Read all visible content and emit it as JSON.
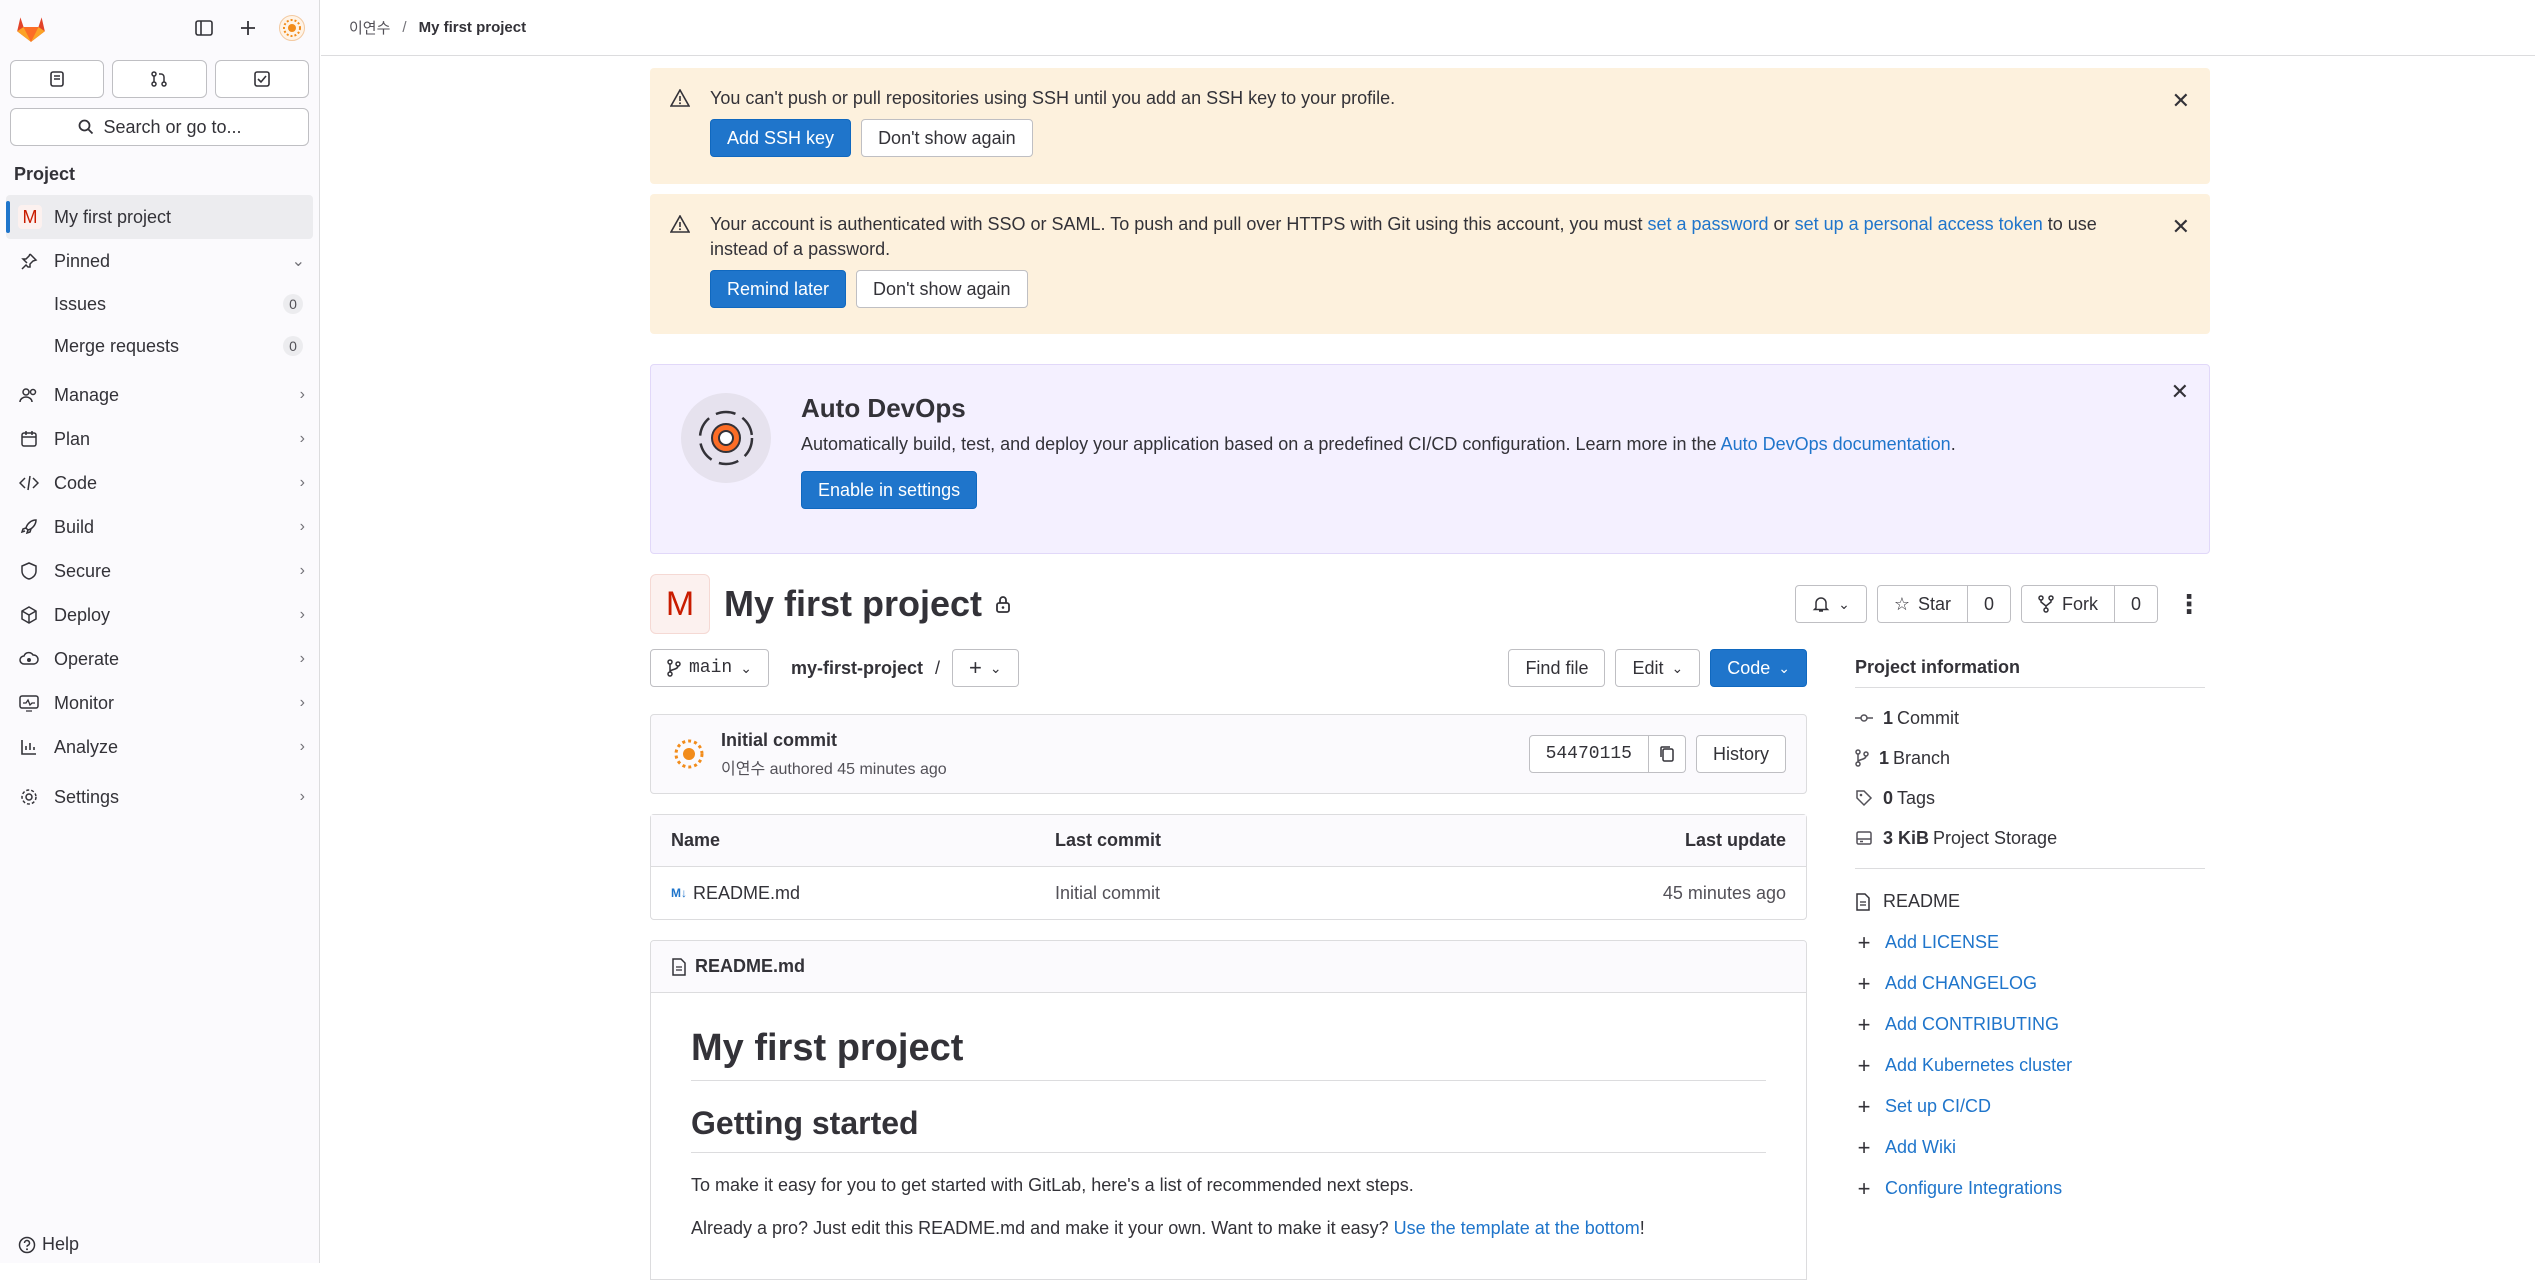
{
  "sidebar": {
    "search_label": "Search or go to...",
    "section": "Project",
    "project_item": {
      "avatar": "M",
      "label": "My first project"
    },
    "pinned": {
      "label": "Pinned",
      "items": [
        {
          "label": "Issues",
          "count": "0"
        },
        {
          "label": "Merge requests",
          "count": "0"
        }
      ]
    },
    "nav": [
      "Manage",
      "Plan",
      "Code",
      "Build",
      "Secure",
      "Deploy",
      "Operate",
      "Monitor",
      "Analyze",
      "Settings"
    ],
    "help": "Help"
  },
  "breadcrumb": {
    "user": "이연수",
    "project": "My first project"
  },
  "alerts": {
    "ssh": {
      "text": "You can't push or pull repositories using SSH until you add an SSH key to your profile.",
      "primary": "Add SSH key",
      "secondary": "Don't show again"
    },
    "sso": {
      "text_before": "Your account is authenticated with SSO or SAML. To push and pull over HTTPS with Git using this account, you must ",
      "link1": "set a password",
      "mid": " or ",
      "link2": "set up a personal access token",
      "text_after": " to use instead of a password.",
      "primary": "Remind later",
      "secondary": "Don't show again"
    }
  },
  "devops": {
    "title": "Auto DevOps",
    "text": "Automatically build, test, and deploy your application based on a predefined CI/CD configuration. Learn more in the ",
    "link": "Auto DevOps documentation",
    "period": ".",
    "button": "Enable in settings"
  },
  "project": {
    "avatar": "M",
    "title": "My first project",
    "star": "Star",
    "star_count": "0",
    "fork": "Fork",
    "fork_count": "0"
  },
  "repo": {
    "branch": "main",
    "path": "my-first-project",
    "slash": "/",
    "find_file": "Find file",
    "edit": "Edit",
    "code": "Code"
  },
  "commit": {
    "title": "Initial commit",
    "author": "이연수",
    "meta": " authored 45 minutes ago",
    "sha": "54470115",
    "history": "History"
  },
  "files": {
    "headers": [
      "Name",
      "Last commit",
      "Last update"
    ],
    "rows": [
      {
        "name": "README.md",
        "last_commit": "Initial commit",
        "last_update": "45 minutes ago"
      }
    ]
  },
  "readme": {
    "file": "README.md",
    "h1": "My first project",
    "h2": "Getting started",
    "p1": "To make it easy for you to get started with GitLab, here's a list of recommended next steps.",
    "p2_before": "Already a pro? Just edit this README.md and make it your own. Want to make it easy? ",
    "p2_link": "Use the template at the bottom",
    "p2_after": "!"
  },
  "project_info": {
    "title": "Project information",
    "stats": [
      {
        "num": "1",
        "label": "Commit"
      },
      {
        "num": "1",
        "label": "Branch"
      },
      {
        "num": "0",
        "label": "Tags"
      },
      {
        "num": "3 KiB",
        "label": "Project Storage"
      }
    ],
    "readme": "README",
    "links": [
      "Add LICENSE",
      "Add CHANGELOG",
      "Add CONTRIBUTING",
      "Add Kubernetes cluster",
      "Set up CI/CD",
      "Add Wiki",
      "Configure Integrations"
    ]
  },
  "colors": {
    "accent": "#1f75cb",
    "warning_bg": "#fdf1dd",
    "devops_bg": "#f4f0ff"
  }
}
